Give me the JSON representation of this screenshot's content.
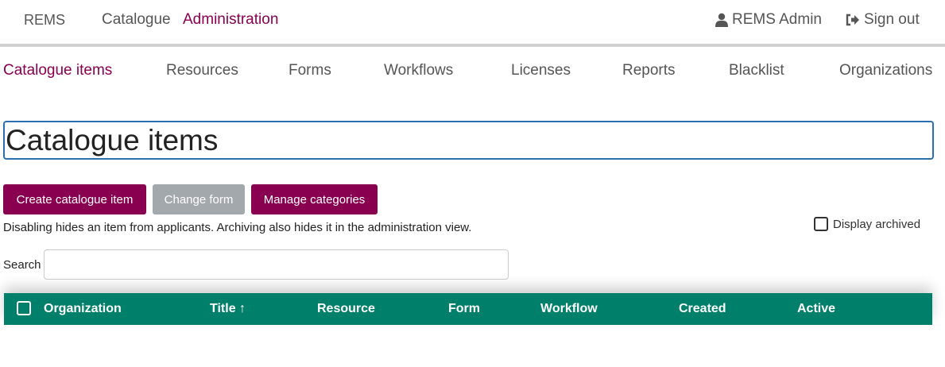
{
  "topnav": {
    "brand": "REMS",
    "catalogue": "Catalogue",
    "administration": "Administration",
    "user": "REMS Admin",
    "signout": "Sign out"
  },
  "subnav": {
    "items": [
      "Catalogue items",
      "Resources",
      "Forms",
      "Workflows",
      "Licenses",
      "Reports",
      "Blacklist",
      "Organizations"
    ],
    "active": "Catalogue items"
  },
  "page": {
    "title": "Catalogue items"
  },
  "actions": {
    "create": "Create catalogue item",
    "change_form": "Change form",
    "manage_categories": "Manage categories"
  },
  "archived": {
    "label": "Display archived",
    "checked": false
  },
  "hint": "Disabling hides an item from applicants. Archiving also hides it in the administration view.",
  "search": {
    "label": "Search",
    "value": "",
    "placeholder": ""
  },
  "table": {
    "columns": [
      "Organization",
      "Title ↑",
      "Resource",
      "Form",
      "Workflow",
      "Created",
      "Active"
    ],
    "header_color": "#00806b"
  },
  "colors": {
    "accent": "#8a0050",
    "disabled": "#a3a8ad",
    "focus_border": "#2a6fb0"
  }
}
